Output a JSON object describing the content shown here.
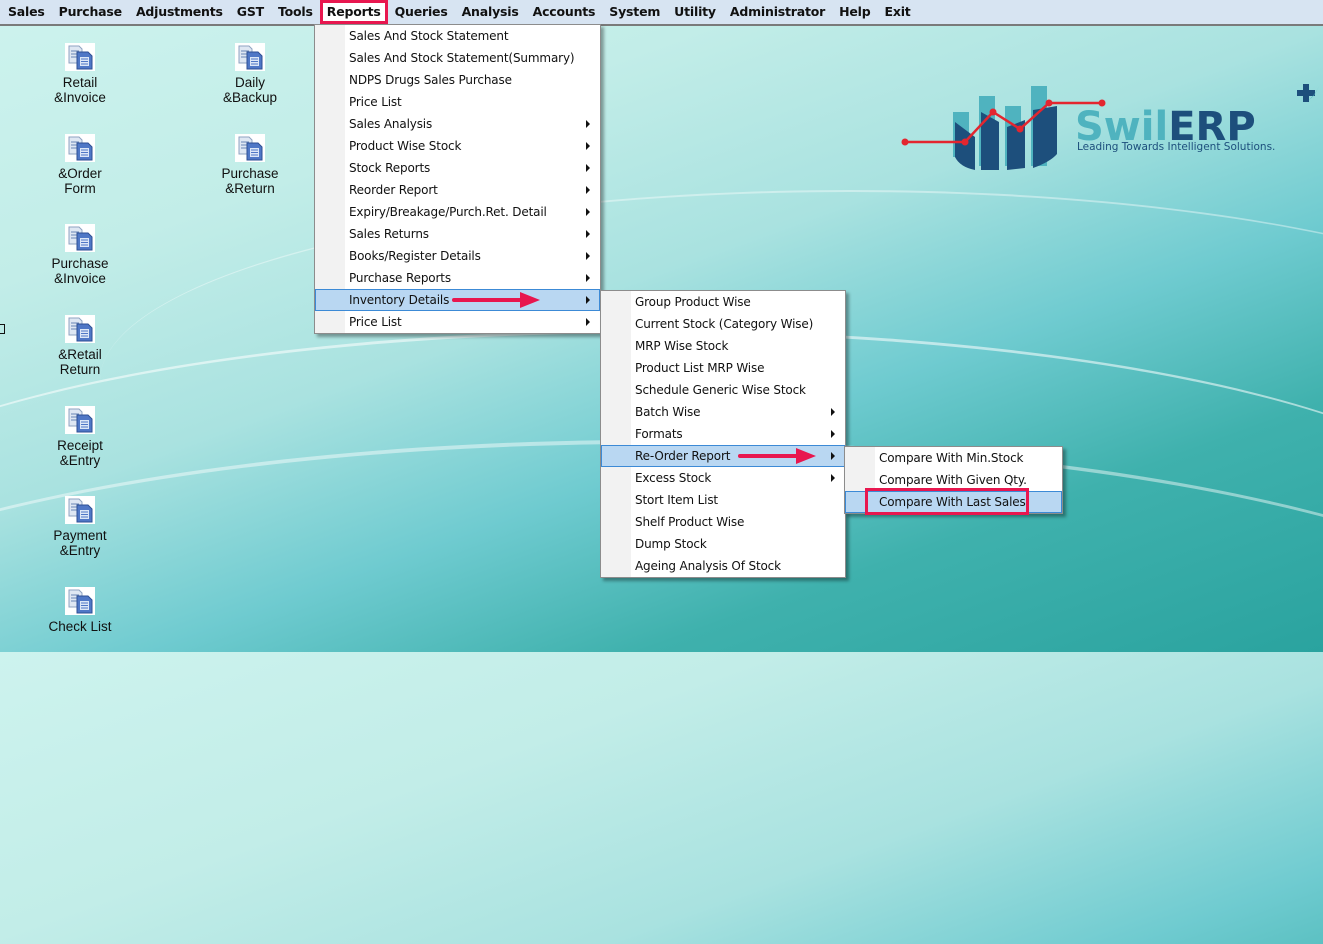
{
  "menubar": {
    "items": [
      "Sales",
      "Purchase",
      "Adjustments",
      "GST",
      "Tools",
      "Reports",
      "Queries",
      "Analysis",
      "Accounts",
      "System",
      "Utility",
      "Administrator",
      "Help",
      "Exit"
    ],
    "active": "Reports"
  },
  "reports_menu": {
    "items": [
      {
        "label": "Sales And Stock Statement",
        "submenu": false
      },
      {
        "label": "Sales And Stock Statement(Summary)",
        "submenu": false
      },
      {
        "label": "NDPS Drugs Sales  Purchase",
        "submenu": false
      },
      {
        "label": "Price List",
        "submenu": false
      },
      {
        "label": "Sales Analysis",
        "submenu": true
      },
      {
        "label": "Product Wise Stock",
        "submenu": true
      },
      {
        "label": "Stock Reports",
        "submenu": true
      },
      {
        "label": "Reorder Report",
        "submenu": true
      },
      {
        "label": "Expiry/Breakage/Purch.Ret. Detail",
        "submenu": true
      },
      {
        "label": "Sales Returns",
        "submenu": true
      },
      {
        "label": "Books/Register Details",
        "submenu": true
      },
      {
        "label": "Purchase Reports",
        "submenu": true
      },
      {
        "label": "Inventory Details",
        "submenu": true,
        "highlighted": true
      },
      {
        "label": "Price List",
        "submenu": true
      }
    ]
  },
  "inventory_menu": {
    "items": [
      {
        "label": "Group Product Wise",
        "submenu": false
      },
      {
        "label": "Current Stock (Category Wise)",
        "submenu": false
      },
      {
        "label": "MRP Wise Stock",
        "submenu": false
      },
      {
        "label": "Product List MRP Wise",
        "submenu": false
      },
      {
        "label": "Schedule Generic Wise Stock",
        "submenu": false
      },
      {
        "label": "Batch Wise",
        "submenu": true
      },
      {
        "label": "Formats",
        "submenu": true
      },
      {
        "label": "Re-Order Report",
        "submenu": true,
        "highlighted": true
      },
      {
        "label": "Excess Stock",
        "submenu": true
      },
      {
        "label": "Stort Item List",
        "submenu": false
      },
      {
        "label": "Shelf Product Wise",
        "submenu": false
      },
      {
        "label": "Dump Stock",
        "submenu": false
      },
      {
        "label": "Ageing Analysis Of Stock",
        "submenu": false
      }
    ]
  },
  "reorder_menu": {
    "items": [
      {
        "label": "Compare With Min.Stock"
      },
      {
        "label": "Compare With Given Qty."
      },
      {
        "label": "Compare With Last Sales",
        "highlighted": true
      }
    ]
  },
  "desktop_icons": [
    {
      "line1": "Retail",
      "line2": "&Invoice"
    },
    {
      "line1": "&Order",
      "line2": "Form"
    },
    {
      "line1": "Purchase",
      "line2": "&Invoice"
    },
    {
      "line1": "&Retail",
      "line2": "Return"
    },
    {
      "line1": "Receipt",
      "line2": "&Entry"
    },
    {
      "line1": "Payment",
      "line2": "&Entry"
    },
    {
      "line1": "Check List",
      "line2": ""
    },
    {
      "line1": "Daily",
      "line2": "&Backup"
    },
    {
      "line1": "Purchase",
      "line2": "&Return"
    }
  ],
  "logo": {
    "brand_light": "Swil",
    "brand_dark": "ERP",
    "tagline": "Leading Towards Intelligent Solutions."
  },
  "colors": {
    "accent_red": "#e8174f",
    "highlight_bg": "#b9d7f2",
    "highlight_border": "#3c8ad6",
    "menubar_bg": "#d7e4f2",
    "logo_teal": "#4fb3bf",
    "logo_navy": "#1d4f7c"
  }
}
